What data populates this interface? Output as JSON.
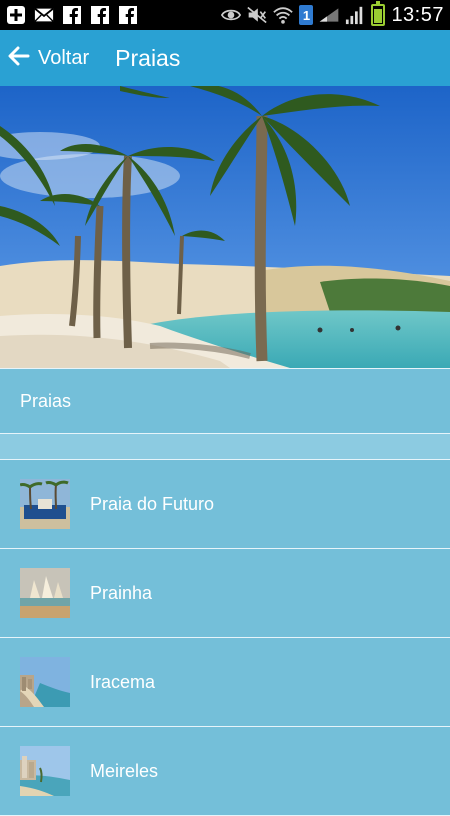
{
  "status_bar": {
    "time": "13:57",
    "sim": "1",
    "icons": [
      "add-icon",
      "mail-icon",
      "facebook-icon",
      "facebook-icon",
      "facebook-icon",
      "eye-icon",
      "mute-icon",
      "wifi-icon",
      "signal-icon",
      "signal-icon",
      "battery-icon"
    ]
  },
  "action_bar": {
    "back_label": "Voltar",
    "title": "Praias"
  },
  "section": {
    "header": "Praias"
  },
  "list": {
    "items": [
      {
        "label": "Praia do Futuro"
      },
      {
        "label": "Prainha"
      },
      {
        "label": "Iracema"
      },
      {
        "label": "Meireles"
      }
    ]
  },
  "colors": {
    "status_bar": "#000000",
    "action_bar": "#2aa1d3",
    "list_bg": "#74bfd9",
    "divider": "#e6f4fa"
  }
}
